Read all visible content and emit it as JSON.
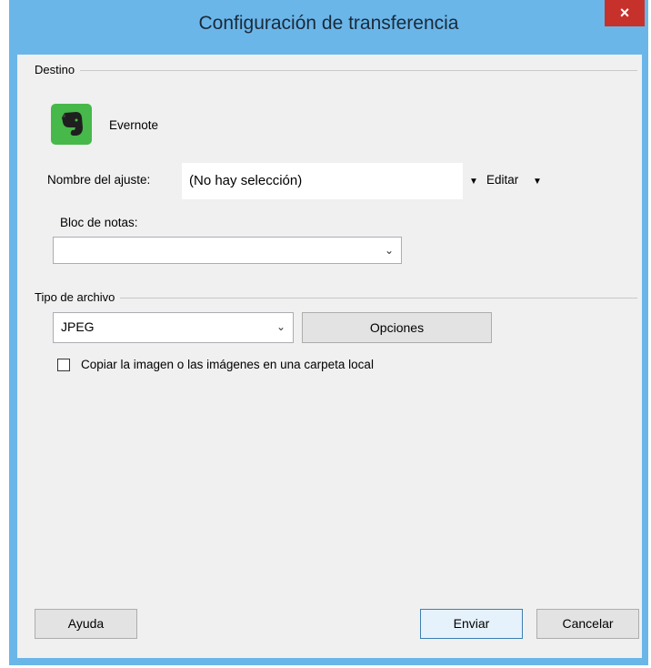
{
  "window": {
    "title": "Configuración de transferencia",
    "close_glyph": "×"
  },
  "destination": {
    "group_label": "Destino",
    "app_name": "Evernote",
    "app_icon": "evernote-icon",
    "setting_label": "Nombre del ajuste:",
    "setting_value": "(No hay selección)",
    "edit_label": "Editar",
    "notebook_label": "Bloc de notas:",
    "notebook_value": ""
  },
  "file_type": {
    "group_label": "Tipo de archivo",
    "selected": "JPEG",
    "options_label": "Opciones",
    "copy_checkbox_label": "Copiar la imagen o las imágenes en una carpeta local",
    "copy_checked": false
  },
  "footer": {
    "help_label": "Ayuda",
    "send_label": "Enviar",
    "cancel_label": "Cancelar"
  },
  "colors": {
    "title_bar": "#6bb6e9",
    "close_button": "#c7312b",
    "evernote_green": "#47b84a",
    "dialog_background": "#f0f0f0"
  }
}
